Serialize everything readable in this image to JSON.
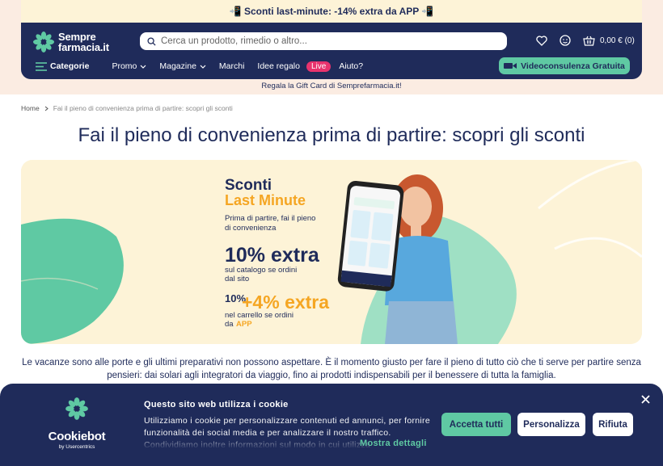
{
  "promo": {
    "text": "📲 Sconti last-minute: -14% extra da APP 📲"
  },
  "header": {
    "logo_line1": "Sempre",
    "logo_line2": "farmacia.it",
    "search_placeholder": "Cerca un prodotto, rimedio o altro...",
    "cart_total": "0,00 € (0)"
  },
  "nav": {
    "categories": "Categorie",
    "promo": "Promo",
    "magazine": "Magazine",
    "marchi": "Marchi",
    "idee_regalo": "Idee regalo",
    "live": "Live",
    "aiuto": "Aiuto?",
    "video_btn": "Videoconsulenza Gratuita"
  },
  "gift_bar": "Regala la Gift Card di Semprefarmacia.it!",
  "breadcrumb": {
    "home": "Home",
    "current": "Fai il pieno di convenienza prima di partire: scopri gli sconti"
  },
  "page_title": "Fai il pieno di convenienza prima di partire: scopri gli sconti",
  "banner": {
    "title1": "Sconti",
    "title2": "Last Minute",
    "lead1": "Prima di partire, fai il pieno",
    "lead2": "di convenienza",
    "offer1_big": "10% extra",
    "offer1_l1": "sul catalogo se ordini",
    "offer1_l2": "dal sito",
    "offer2_a": "10%",
    "offer2_plus": "+4% extra",
    "offer2_l1": "nel carrello se ordini",
    "offer2_l2": "da",
    "offer2_app": "APP"
  },
  "body_text": "Le vacanze sono alle porte e gli ultimi preparativi non possono aspettare. È il momento giusto per fare il pieno di tutto ciò che ti serve per partire senza pensieri: dai solari agli integratori da viaggio, fino ai prodotti indispensabili per il benessere di tutta la famiglia.",
  "cookie": {
    "brand": "Cookiebot",
    "brand_sub": "by Usercentrics",
    "title": "Questo sito web utilizza i cookie",
    "description": "Utilizziamo i cookie per personalizzare contenuti ed annunci, per fornire funzionalità dei social media e per analizzare il nostro traffico. Condividiamo inoltre informazioni sul modo in cui utilizza",
    "more": "Mostra dettagli",
    "accept": "Accetta tutti",
    "customize": "Personalizza",
    "refuse": "Rifiuta",
    "close_icon": "close-icon"
  },
  "colors": {
    "navy": "#1f2b5a",
    "mint": "#5fc9a3",
    "orange": "#f5a623",
    "live": "#e8336e",
    "cream": "#fdf3d7"
  }
}
